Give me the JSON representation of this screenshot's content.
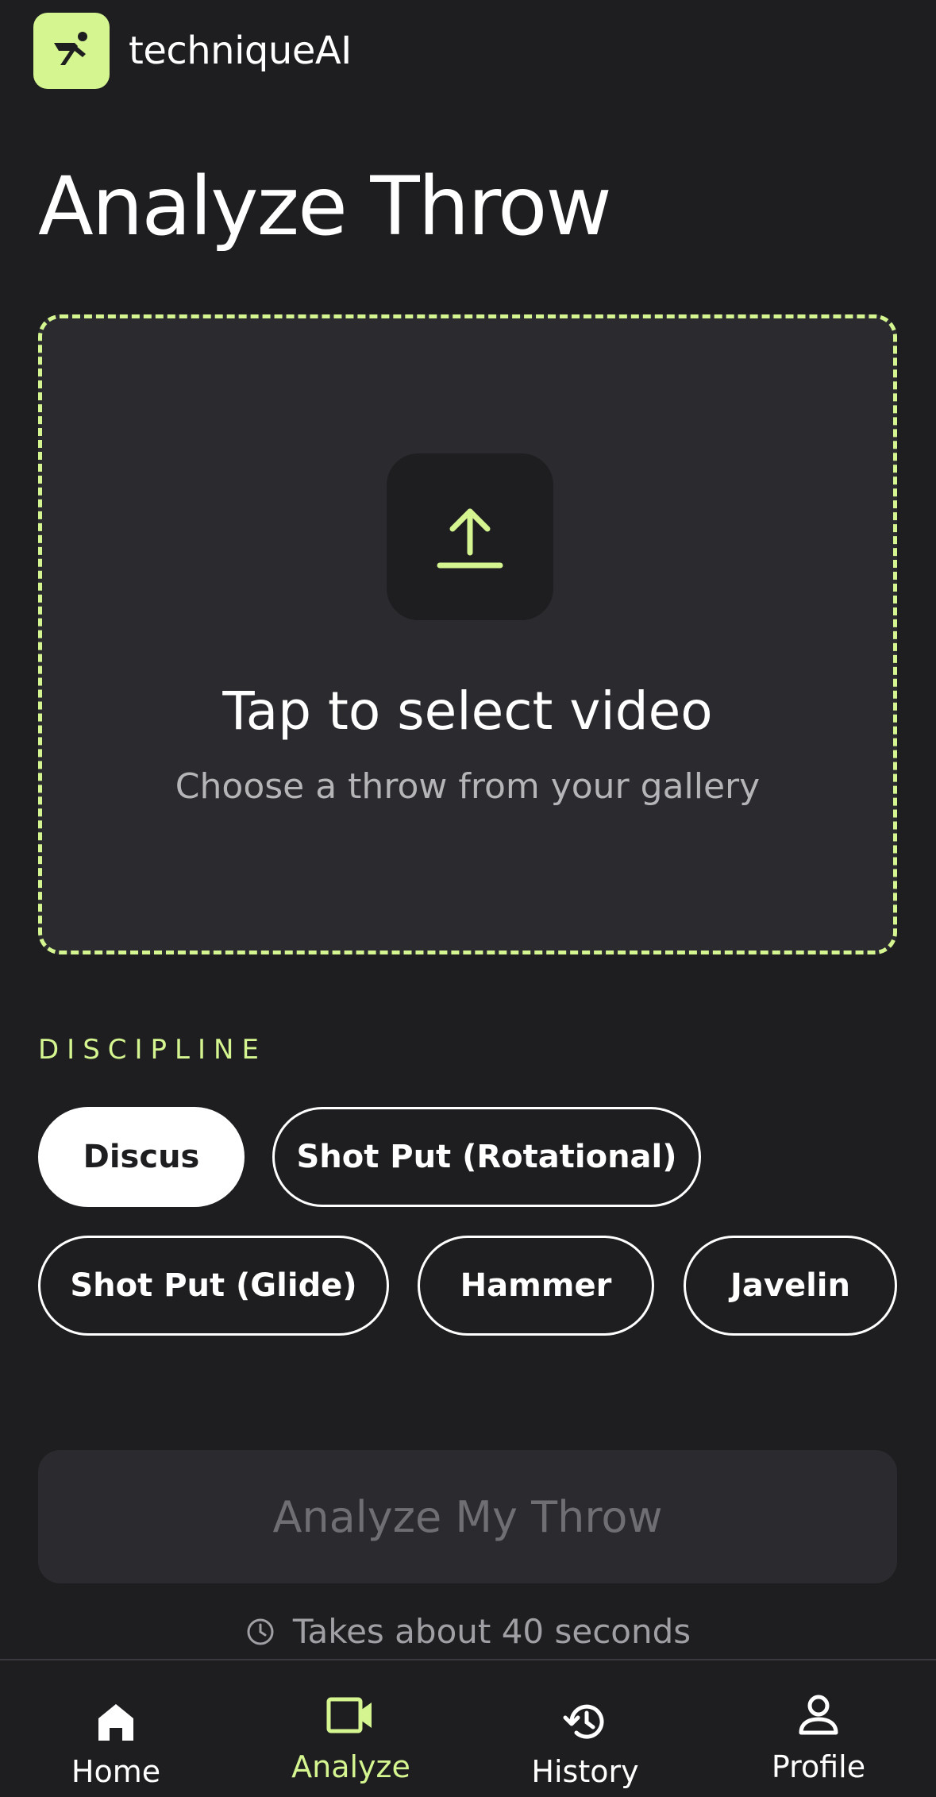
{
  "brand": {
    "name": "techniqueAI",
    "accent_color": "#d4f58f",
    "logo_icon": "thrower-icon"
  },
  "page": {
    "title": "Analyze Throw"
  },
  "upload": {
    "title": "Tap to select video",
    "subtitle": "Choose a throw from your gallery",
    "icon": "upload-icon"
  },
  "discipline": {
    "label": "DISCIPLINE",
    "options": [
      "Discus",
      "Shot Put (Rotational)",
      "Shot Put (Glide)",
      "Hammer",
      "Javelin"
    ],
    "selected": "Discus"
  },
  "analyze_button": {
    "label": "Analyze My Throw",
    "enabled": false
  },
  "hint": {
    "text": "Takes about 40 seconds",
    "icon": "clock-icon"
  },
  "nav": {
    "items": [
      {
        "label": "Home",
        "icon": "home-icon"
      },
      {
        "label": "Analyze",
        "icon": "video-camera-icon"
      },
      {
        "label": "History",
        "icon": "history-icon"
      },
      {
        "label": "Profile",
        "icon": "person-icon"
      }
    ],
    "active": "Analyze"
  }
}
